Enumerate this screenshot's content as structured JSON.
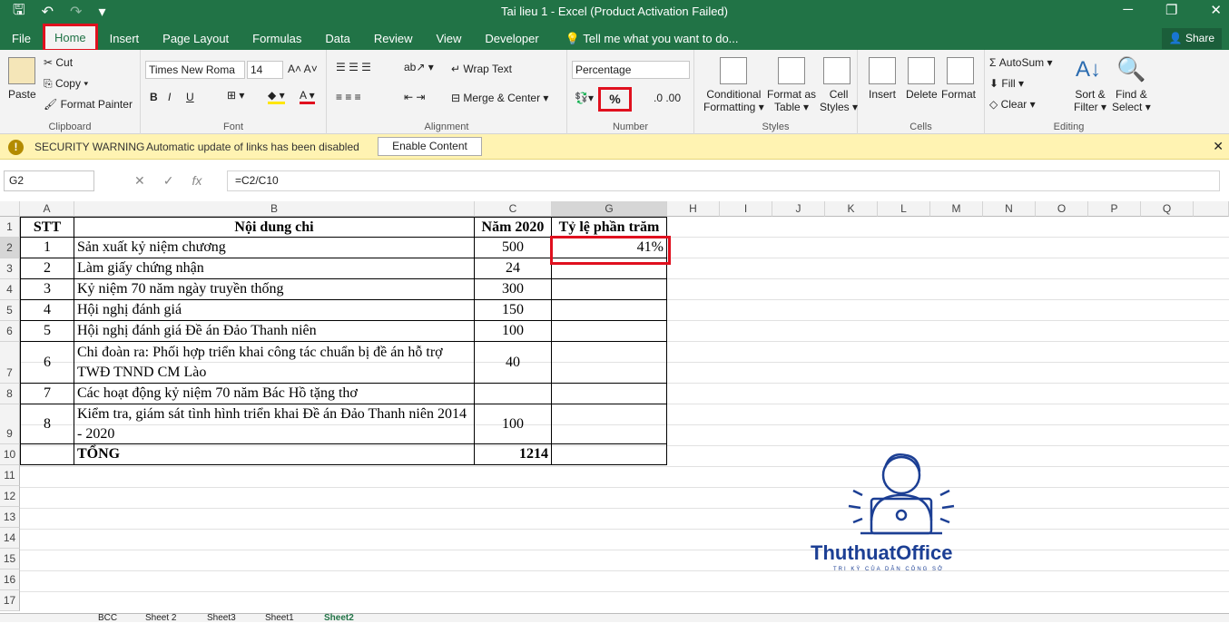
{
  "window": {
    "title": "Tai lieu 1 - Excel (Product Activation Failed)",
    "min": "─",
    "restore": "❐",
    "close": "✕"
  },
  "qat": {
    "save": "🖫",
    "undo": "↶",
    "redo": "↷",
    "custom": "▾"
  },
  "tabs": [
    "File",
    "Home",
    "Insert",
    "Page Layout",
    "Formulas",
    "Data",
    "Review",
    "View",
    "Developer"
  ],
  "tell": "Tell me what you want to do...",
  "share": "Share",
  "clipboard": {
    "paste": "Paste",
    "cut": "Cut",
    "copy": "Copy",
    "painter": "Format Painter",
    "label": "Clipboard"
  },
  "font": {
    "name": "Times New Roma",
    "size": "14",
    "label": "Font"
  },
  "alignment": {
    "wrap": "Wrap Text",
    "merge": "Merge & Center",
    "label": "Alignment"
  },
  "number": {
    "format": "Percentage",
    "pct": "%",
    "label": "Number"
  },
  "styles": {
    "cond": "Conditional",
    "cond2": "Formatting",
    "fmt": "Format as",
    "fmt2": "Table",
    "cell": "Cell",
    "cell2": "Styles",
    "label": "Styles"
  },
  "cells": {
    "insert": "Insert",
    "delete": "Delete",
    "format": "Format",
    "label": "Cells"
  },
  "editing": {
    "autosum": "AutoSum",
    "fill": "Fill",
    "clear": "Clear",
    "sort": "Sort &",
    "sort2": "Filter",
    "find": "Find &",
    "find2": "Select",
    "label": "Editing"
  },
  "security": {
    "title": "SECURITY WARNING",
    "msg": "Automatic update of links has been disabled",
    "button": "Enable Content"
  },
  "formula": {
    "namebox": "G2",
    "content": "=C2/C10"
  },
  "columns": [
    "A",
    "B",
    "C",
    "G",
    "H",
    "I",
    "J",
    "K",
    "L",
    "M",
    "N",
    "O",
    "P",
    "Q"
  ],
  "rows": [
    "1",
    "2",
    "3",
    "4",
    "5",
    "6",
    "7",
    "8",
    "9",
    "10",
    "11",
    "12",
    "13",
    "14",
    "15",
    "16",
    "17"
  ],
  "table": {
    "header": {
      "stt": "STT",
      "noidung": "Nội dung chi",
      "nam": "Năm 2020",
      "tyle": "Tỷ lệ phần trăm"
    },
    "rows": [
      {
        "stt": "1",
        "nd": "Sản xuất kỷ niệm chương",
        "v": "500",
        "p": "41%"
      },
      {
        "stt": "2",
        "nd": "Làm giấy chứng nhận",
        "v": "24",
        "p": ""
      },
      {
        "stt": "3",
        "nd": "Kỷ niệm 70 năm ngày truyền thống",
        "v": "300",
        "p": ""
      },
      {
        "stt": "4",
        "nd": "Hội nghị đánh giá",
        "v": "150",
        "p": ""
      },
      {
        "stt": "5",
        "nd": "Hội nghị đánh giá Đề án Đảo Thanh niên",
        "v": "100",
        "p": ""
      },
      {
        "stt": "6",
        "nd": "Chi đoàn ra: Phối hợp triển khai công tác chuẩn bị đề án hỗ trợ TWĐ TNND CM Lào",
        "v": "40",
        "p": ""
      },
      {
        "stt": "7",
        "nd": "Các hoạt động kỷ niệm 70 năm Bác Hồ tặng thơ",
        "v": "",
        "p": ""
      },
      {
        "stt": "8",
        "nd": "Kiểm tra, giám sát tình hình triển khai Đề án Đảo Thanh niên 2014 - 2020",
        "v": "100",
        "p": ""
      }
    ],
    "total": {
      "label": "TỔNG",
      "v": "1214"
    }
  },
  "sheets": [
    "BCC",
    "Sheet 2",
    "Sheet3",
    "Sheet1",
    "Sheet2"
  ],
  "logo": {
    "name": "ThuthuatOffice",
    "tagline": "TRI KỲ CỦA DÂN CÔNG SỞ"
  }
}
